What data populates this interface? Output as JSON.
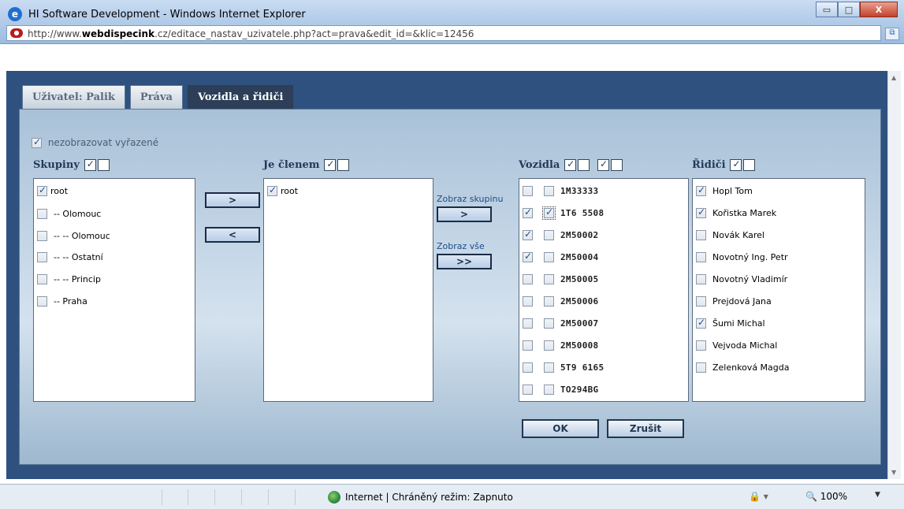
{
  "window": {
    "title": "HI Software Development - Windows Internet Explorer",
    "min_label": "▭",
    "max_label": "□",
    "close_label": "X"
  },
  "address": {
    "url_prefix": "http://www.",
    "url_domain": "webdispecink",
    "url_suffix": ".cz/editace_nastav_uzivatele.php?act=prava&edit_id=&klic=12456"
  },
  "tabs": [
    {
      "label": "Uživatel:  Palik",
      "active": false
    },
    {
      "label": "Práva",
      "active": false
    },
    {
      "label": "Vozidla a řidiči",
      "active": true
    }
  ],
  "filter": {
    "label": "nezobrazovat vyřazené",
    "checked": true
  },
  "skupiny": {
    "header": "Skupiny",
    "items": [
      {
        "label": "root",
        "checked": true
      },
      {
        "label": "-- Olomouc",
        "checked": false
      },
      {
        "label": "-- -- Olomouc",
        "checked": false
      },
      {
        "label": "-- -- Ostatní",
        "checked": false
      },
      {
        "label": "-- -- Princip",
        "checked": false
      },
      {
        "label": "-- Praha",
        "checked": false
      }
    ]
  },
  "move_buttons": {
    "add": ">",
    "remove": "<"
  },
  "clenem": {
    "header": "Je členem",
    "items": [
      {
        "label": "root",
        "checked": true
      }
    ]
  },
  "zobraz": {
    "skupinu_label": "Zobraz skupinu",
    "skupinu_button": ">",
    "vse_label": "Zobraz vše",
    "vse_button": ">>"
  },
  "vozidla": {
    "header": "Vozidla",
    "items": [
      {
        "label": "1M33333",
        "checked1": false,
        "checked2": false,
        "focus": false
      },
      {
        "label": "1T6 5508",
        "checked1": true,
        "checked2": true,
        "focus": true
      },
      {
        "label": "2M50002",
        "checked1": true,
        "checked2": false,
        "focus": false
      },
      {
        "label": "2M50004",
        "checked1": true,
        "checked2": false,
        "focus": false
      },
      {
        "label": "2M50005",
        "checked1": false,
        "checked2": false,
        "focus": false
      },
      {
        "label": "2M50006",
        "checked1": false,
        "checked2": false,
        "focus": false
      },
      {
        "label": "2M50007",
        "checked1": false,
        "checked2": false,
        "focus": false
      },
      {
        "label": "2M50008",
        "checked1": false,
        "checked2": false,
        "focus": false
      },
      {
        "label": "5T9 6165",
        "checked1": false,
        "checked2": false,
        "focus": false
      },
      {
        "label": "TO294BG",
        "checked1": false,
        "checked2": false,
        "focus": false
      }
    ]
  },
  "ridici": {
    "header": "Řidiči",
    "items": [
      {
        "label": "Hopl Tom",
        "checked": true
      },
      {
        "label": "Kořistka Marek",
        "checked": true
      },
      {
        "label": "Novák Karel",
        "checked": false
      },
      {
        "label": "Novotný Ing. Petr",
        "checked": false
      },
      {
        "label": "Novotný Vladimír",
        "checked": false
      },
      {
        "label": "Prejdová Jana",
        "checked": false
      },
      {
        "label": "Šumi Michal",
        "checked": true
      },
      {
        "label": "Vejvoda Michal",
        "checked": false
      },
      {
        "label": "Zelenková Magda",
        "checked": false
      }
    ]
  },
  "actions": {
    "ok": "OK",
    "cancel": "Zrušit"
  },
  "status": {
    "zone_text": "Internet | Chráněný režim: Zapnuto",
    "zoom": "100%"
  }
}
